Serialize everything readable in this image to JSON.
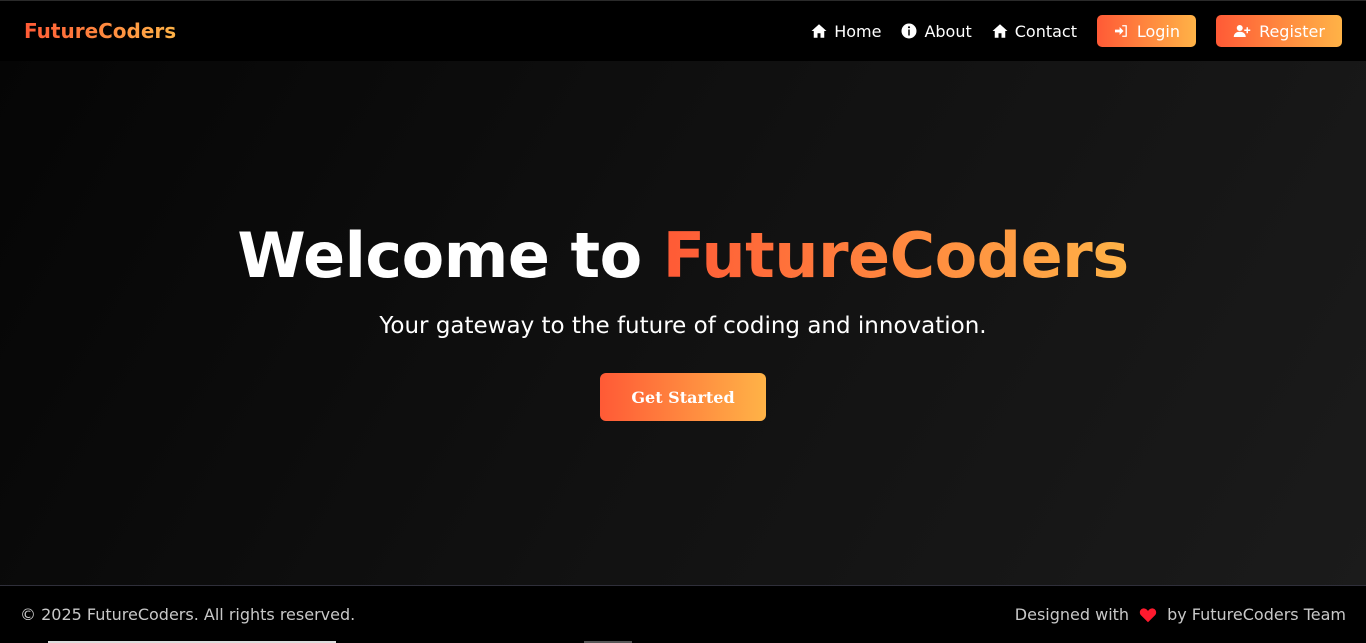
{
  "navbar": {
    "brand": "FutureCoders",
    "links": [
      {
        "label": "Home",
        "icon": "home-icon"
      },
      {
        "label": "About",
        "icon": "info-icon"
      },
      {
        "label": "Contact",
        "icon": "home-icon"
      }
    ],
    "login_label": "Login",
    "register_label": "Register"
  },
  "hero": {
    "title_prefix": "Welcome to ",
    "title_accent": "FutureCoders",
    "subtitle": "Your gateway to the future of coding and innovation.",
    "cta_label": "Get Started"
  },
  "footer": {
    "copyright": "© 2025 FutureCoders. All rights reserved.",
    "designed_prefix": "Designed with",
    "designed_suffix": "by FutureCoders Team"
  },
  "colors": {
    "accent_start": "#ff5a36",
    "accent_end": "#ffb347",
    "background": "#000000",
    "heart": "#ff1a2e"
  }
}
